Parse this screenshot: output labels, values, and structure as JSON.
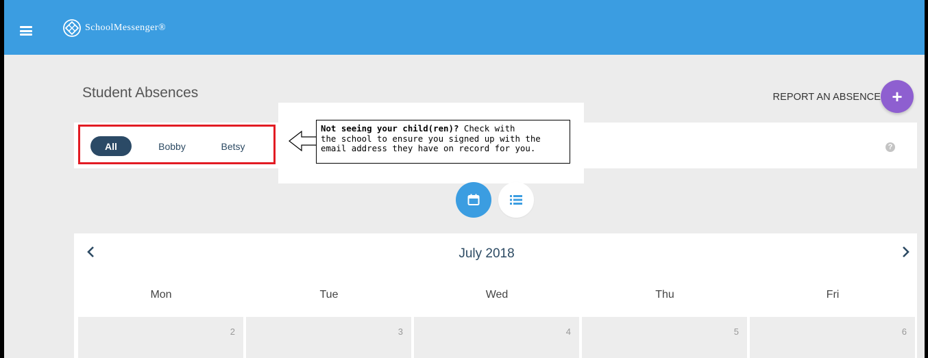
{
  "app": {
    "brand": "SchoolMessenger®",
    "header_color": "#3b9de1"
  },
  "page": {
    "title": "Student Absences",
    "report_label": "REPORT AN ABSENCE",
    "report_icon": "plus-icon",
    "accent_purple": "#8e5fd0"
  },
  "filters": {
    "items": [
      {
        "label": "All",
        "selected": true
      },
      {
        "label": "Bobby",
        "selected": false
      },
      {
        "label": "Betsy",
        "selected": false
      }
    ],
    "help_icon": "question-icon"
  },
  "callout": {
    "bold": "Not seeing your child(ren)?",
    "line1": "Check with",
    "line2": "the school to ensure you signed up with the",
    "line3": "email address they have on record for you."
  },
  "views": {
    "calendar_icon": "calendar-icon",
    "list_icon": "list-icon",
    "active": "calendar"
  },
  "calendar": {
    "month": "July 2018",
    "weekdays": [
      "Mon",
      "Tue",
      "Wed",
      "Thu",
      "Fri"
    ],
    "days": [
      "2",
      "3",
      "4",
      "5",
      "6"
    ]
  }
}
